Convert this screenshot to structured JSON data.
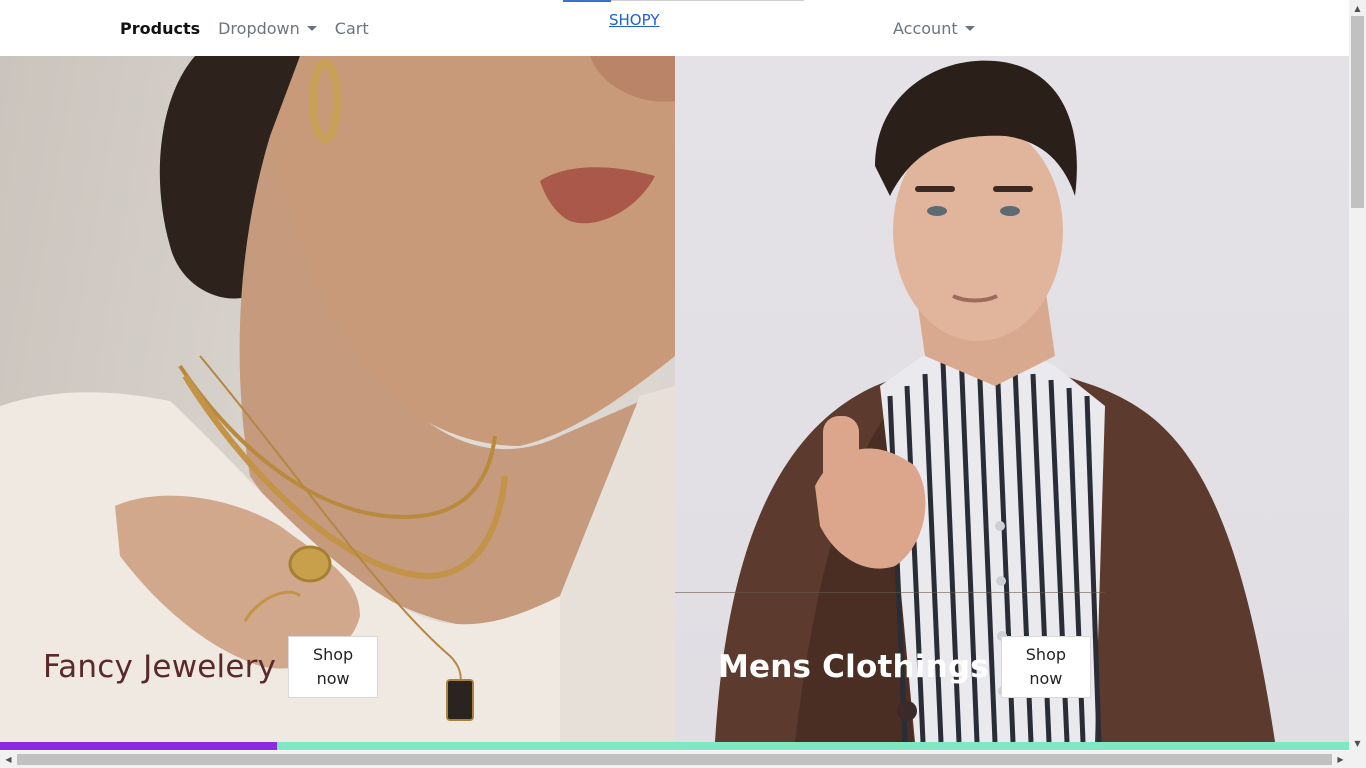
{
  "nav": {
    "products": "Products",
    "dropdown": "Dropdown",
    "cart": "Cart",
    "brand": "SHOPY",
    "account": "Account"
  },
  "hero": {
    "left": {
      "title": "Fancy Jewelery",
      "button_line1": "Shop",
      "button_line2": "now"
    },
    "right": {
      "title": "Mens Clothings",
      "button_line1": "Shop",
      "button_line2": "now"
    }
  },
  "progress": {
    "value_percent": 20.5,
    "fill_color": "#8a2be2",
    "track_color": "#7ee8c3"
  },
  "icons": {
    "dropdown_caret": "caret-down-icon",
    "scroll_up": "scroll-up-arrow-icon",
    "scroll_down": "scroll-down-arrow-icon",
    "scroll_left": "scroll-left-arrow-icon",
    "scroll_right": "scroll-right-arrow-icon"
  },
  "colors": {
    "brand_link": "#1e5fd6",
    "left_caption": "#5a2a2a",
    "right_caption": "#ffffff"
  }
}
